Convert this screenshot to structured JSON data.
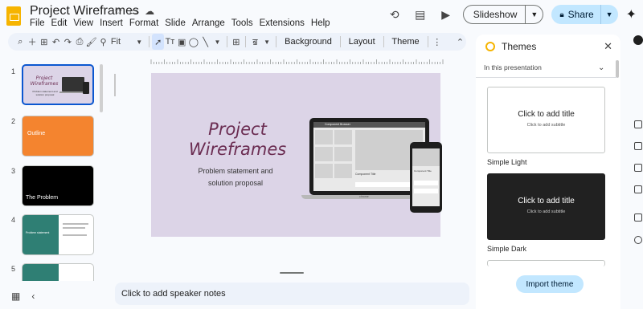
{
  "document": {
    "title": "Project Wireframes"
  },
  "menu": [
    "File",
    "Edit",
    "View",
    "Insert",
    "Format",
    "Slide",
    "Arrange",
    "Tools",
    "Extensions",
    "Help"
  ],
  "header": {
    "slideshow_label": "Slideshow",
    "share_label": "Share"
  },
  "toolbar": {
    "zoom_value": "Fit",
    "background_label": "Background",
    "layout_label": "Layout",
    "theme_label": "Theme"
  },
  "filmstrip": {
    "slides": [
      {
        "number": "1",
        "title": "Project Wireframes",
        "subtitle": "Problem statement and solution proposal"
      },
      {
        "number": "2",
        "title": "Outline"
      },
      {
        "number": "3",
        "title": "The Problem"
      },
      {
        "number": "4",
        "title": "Problem statement"
      },
      {
        "number": "5",
        "title": ""
      }
    ]
  },
  "slide": {
    "title_line1": "Project",
    "title_line2": "Wireframes",
    "subtitle_line1": "Problem statement and",
    "subtitle_line2": "solution proposal",
    "mockup": {
      "app_header": "Component Browser",
      "component_title": "Component Title",
      "laptop_brand": "chrome"
    }
  },
  "notes": {
    "placeholder": "Click to add speaker notes"
  },
  "themes_panel": {
    "title": "Themes",
    "section": "In this presentation",
    "themes": [
      {
        "name": "Simple Light",
        "preview_title": "Click to add title",
        "preview_subtitle": "Click to add subtitle"
      },
      {
        "name": "Simple Dark",
        "preview_title": "Click to add title",
        "preview_subtitle": "Click to add subtitle"
      }
    ],
    "import_label": "Import theme"
  },
  "colors": {
    "accent": "#0b57d0",
    "share_bg": "#c2e7ff",
    "slide_bg": "#dcd4e7",
    "slide_title": "#6b2d52",
    "orange_slide": "#f4842f"
  }
}
